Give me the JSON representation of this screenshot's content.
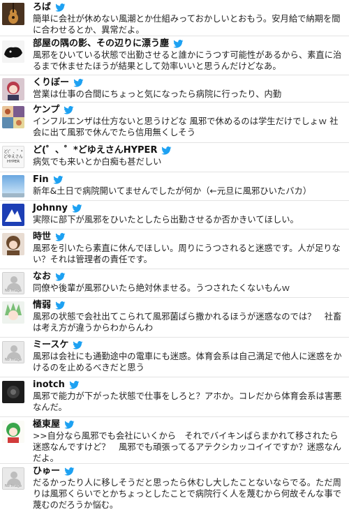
{
  "colors": {
    "twitter_blue": "#1da1f2",
    "divider": "#e3e3e3",
    "text": "#222222"
  },
  "tweets": [
    {
      "name": "ろば",
      "text": "簡単に会社が休めない風潮とか仕組みっておかしいとおもう。安月給で納期を間に合わせるとか、異常だよ。",
      "avatar": "guitar-avatar"
    },
    {
      "name": "部屋の隅の影、その辺りに漂う塵",
      "text": "風邪をひいている状態で出勤させると誰かにうつす可能性があるから、素直に治るまで休ませたほうが結果として効率いいと思うんだけどなあ。",
      "avatar": "sketch-avatar"
    },
    {
      "name": "くりぼー",
      "text": "営業は仕事の合間にちょっと気になったら病院に行ったり、内勤",
      "avatar": "anime-avatar"
    },
    {
      "name": "ケンプ",
      "text": "インフルエンザは仕方ないと思うけどな 風邪で休めるのは学生だけでしょｗ 社会に出て風邪で休んでたら信用無くしそう",
      "avatar": "collage-avatar"
    },
    {
      "name": "ど(゜、゜*どゆえさんHYPER",
      "text": "病気でも来いとか白痴も甚だしい",
      "avatar": "text-avatar",
      "avatar_text": "ど(゜、゜*どゆえさんHYPER"
    },
    {
      "name": "Fin",
      "text": "新年&土日で病院開いてませんでしたが何か（←元旦に風邪ひいたバカ）",
      "avatar": "sky-avatar"
    },
    {
      "name": "Johnny",
      "text": "実際に部下が風邪をひいたとしたら出勤させるか否かきいてほしい。",
      "avatar": "blue-avatar"
    },
    {
      "name": "時世",
      "text": "風邪を引いたら素直に休んでほしい。周りにうつされると迷惑です。人が足りない？それは管理者の責任です。",
      "avatar": "anime-avatar-2"
    },
    {
      "name": "なお",
      "text": "同僚や後輩が風邪ひいたら絶対休ませる。うつされたくないもんｗ",
      "avatar": "no-image-avatar",
      "noimg_label": "No Image"
    },
    {
      "name": "情弱",
      "text": "風邪の状態で会社出てこられて風邪菌ばら撒かれるほうが迷惑なのでは？　社畜は考え方が違うからわからんわ",
      "avatar": "anime-avatar-3"
    },
    {
      "name": "ミースケ",
      "text": "風邪は会社にも通勤途中の電車にも迷惑。体育会系は自己満足で他人に迷惑をかけるのを止めるべきだと思う",
      "avatar": "no-image-avatar",
      "noimg_label": "No Image"
    },
    {
      "name": "inotch",
      "text": "風邪で能力が下がった状態で仕事をしろと？アホか。コレだから体育会系は害悪なんだ。",
      "avatar": "dark-avatar"
    },
    {
      "name": "極東屋",
      "text": ">>自分なら風邪でも会社にいくから　それでバイキンばらまかれて移されたら迷惑なんですけど？　風邪でも頑張ってるアテクシカッコイイですか？迷惑なんだよ。",
      "avatar": "green-anime-avatar"
    },
    {
      "name": "ひゅー",
      "text": "だるかったり人に移しそうだと思ったら休むし大したことないならでる。ただ周りは風邪くらいでとかちょっとしたことで病院行く人を蔑むから何故そんな事で蔑むのだろうか悩む。",
      "avatar": "no-image-avatar",
      "noimg_label": "No Image"
    }
  ]
}
